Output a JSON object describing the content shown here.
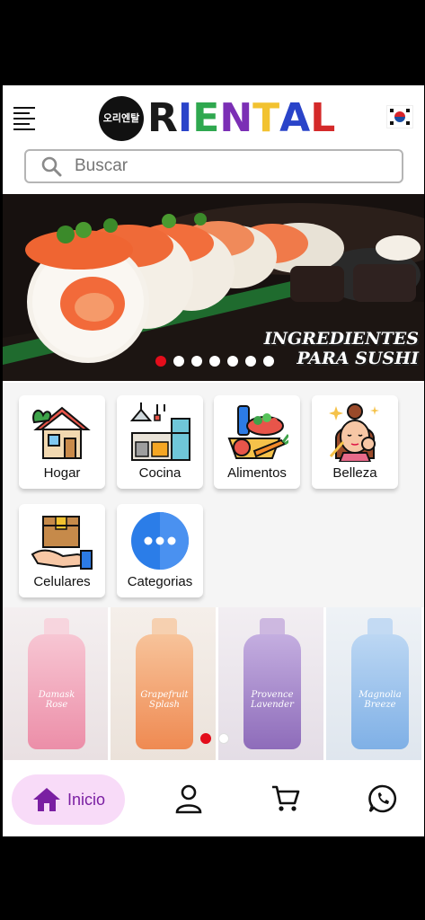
{
  "header": {
    "logo_text": "ORIENTAL",
    "logo_badge": "오리엔탈",
    "logo_letters": [
      {
        "ch": "R",
        "color": "#1a1a1a"
      },
      {
        "ch": "I",
        "color": "#2a44c9"
      },
      {
        "ch": "E",
        "color": "#2fa84f"
      },
      {
        "ch": "N",
        "color": "#7b2fb5"
      },
      {
        "ch": "T",
        "color": "#f2c230"
      },
      {
        "ch": "A",
        "color": "#2a44c9"
      },
      {
        "ch": "L",
        "color": "#d42a2a"
      }
    ]
  },
  "search": {
    "placeholder": "Buscar"
  },
  "banner": {
    "line1": "INGREDIENTES",
    "line2": "PARA SUSHI",
    "slides": 7,
    "active_slide": 0
  },
  "categories": [
    {
      "label": "Hogar",
      "icon": "house-icon"
    },
    {
      "label": "Cocina",
      "icon": "kitchen-icon"
    },
    {
      "label": "Alimentos",
      "icon": "food-icon"
    },
    {
      "label": "Belleza",
      "icon": "beauty-icon"
    },
    {
      "label": "Celulares",
      "icon": "phone-box-icon"
    },
    {
      "label": "Categorias",
      "icon": "more-icon"
    }
  ],
  "products": [
    {
      "name": "Damask Rose",
      "color": "#f1a6b8"
    },
    {
      "name": "Grapefruit Splash",
      "color": "#f4a36a"
    },
    {
      "name": "Provence Lavender",
      "color": "#a98bc9"
    },
    {
      "name": "Magnolia Breeze",
      "color": "#9cc3ec"
    }
  ],
  "product_slides": 2,
  "product_active_slide": 0,
  "nav": {
    "home_label": "Inicio"
  },
  "colors": {
    "accent_red": "#e30d1b",
    "nav_active_bg": "#f8dbf8",
    "nav_active_fg": "#7a1fa2"
  }
}
